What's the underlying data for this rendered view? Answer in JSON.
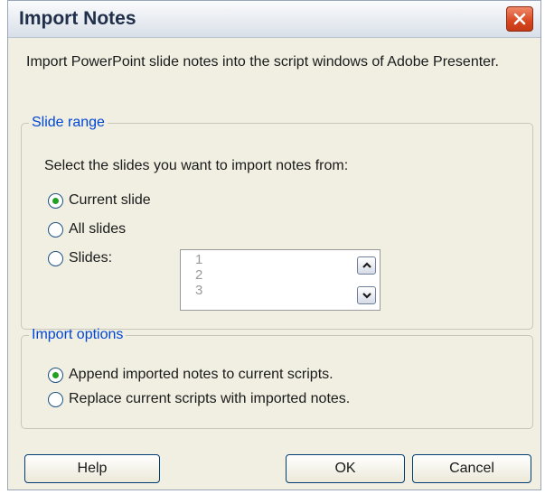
{
  "window": {
    "title": "Import Notes",
    "close_icon": "close-icon"
  },
  "intro_text": "Import PowerPoint slide notes into the script windows of Adobe Presenter.",
  "slide_range": {
    "legend": "Slide range",
    "prompt": "Select the slides you want to import notes from:",
    "options": [
      {
        "label": "Current slide",
        "checked": true
      },
      {
        "label": "All slides",
        "checked": false
      },
      {
        "label": "Slides:",
        "checked": false
      }
    ],
    "slides_list": [
      "1",
      "2",
      "3"
    ]
  },
  "import_options": {
    "legend": "Import options",
    "options": [
      {
        "label": "Append imported notes to current scripts.",
        "checked": true
      },
      {
        "label": "Replace current scripts with imported notes.",
        "checked": false
      }
    ]
  },
  "buttons": {
    "help": "Help",
    "ok": "OK",
    "cancel": "Cancel"
  },
  "colors": {
    "legend_text": "#0046d5",
    "dialog_bg": "#f1efe2",
    "close_button": "#d8461f",
    "radio_dot": "#21a121"
  }
}
